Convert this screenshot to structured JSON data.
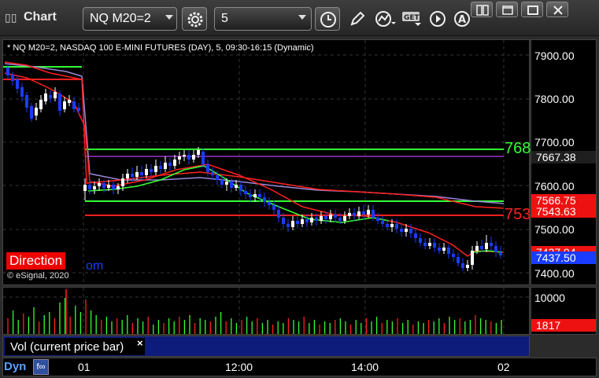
{
  "window": {
    "title": "Chart",
    "symbol": "NQ M20=2",
    "interval": "5",
    "icons": [
      "settings-gear-icon",
      "clock-icon",
      "pencil-draw-icon",
      "study-indicator-icon",
      "get-data-icon",
      "play-icon",
      "alert-icon"
    ],
    "window_controls": [
      "link-icon",
      "restore-icon",
      "maximize-icon",
      "close-icon"
    ]
  },
  "chart": {
    "header": "* NQ M20=2, NASDAQ 100 E-MINI FUTURES (DAY), 5, 09:30-16:15 (Dynamic)",
    "copyright": "© eSignal, 2020",
    "direction_label": "Direction",
    "direction_suffix": "om",
    "upper_line_label": "768",
    "lower_line_label": "753",
    "colors": {
      "background": "#000000",
      "up_candle": "#ffffff",
      "down_candle": "#1a3cff",
      "green_lines": "#33ff33",
      "red_lines": "#ff2020",
      "purple_ma": "#9a88d8"
    }
  },
  "price_axis": {
    "ticks": [
      "7900.00",
      "7800.00",
      "7700.00",
      "7600.00",
      "7500.00",
      "7400.00"
    ],
    "badges": {
      "top": "7667.38",
      "red_a": "7566.75",
      "red_b": "7543.63",
      "partial": "7437.94",
      "last": "7437.50"
    }
  },
  "volume": {
    "study_label": "Vol (current price bar)",
    "close_label": "×",
    "axis_tick": "10000",
    "last_value": "1817"
  },
  "time_axis": {
    "dyn_label": "Dyn",
    "labels": [
      "01",
      "12:00",
      "14:00",
      "02"
    ]
  }
}
